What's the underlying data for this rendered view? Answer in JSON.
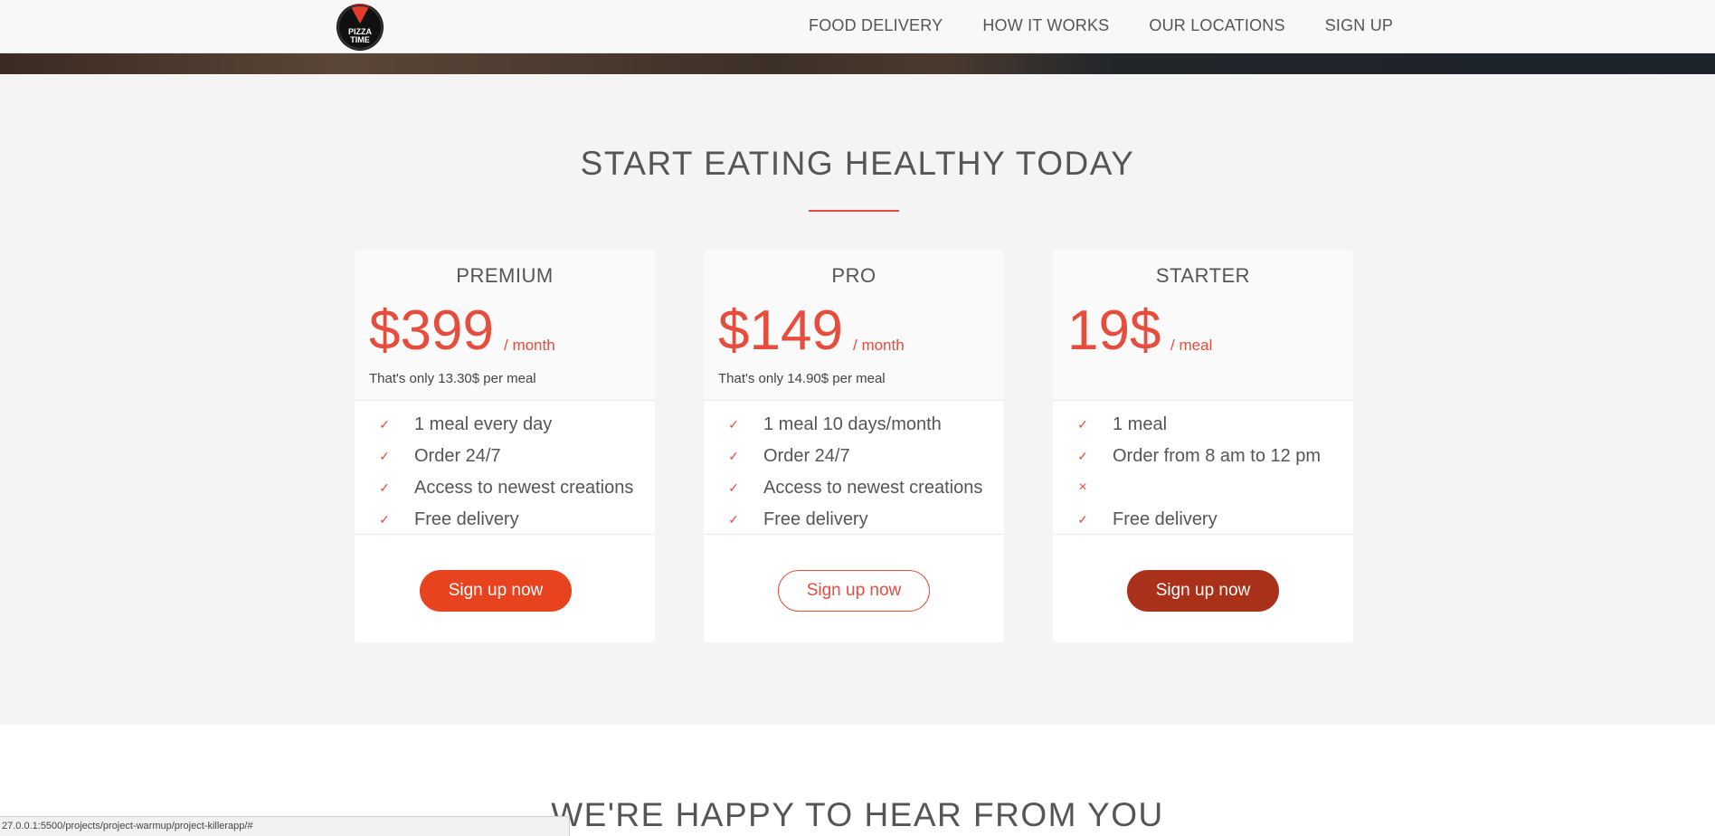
{
  "logo": {
    "line1": "PIZZA",
    "line2": "TIME"
  },
  "nav": {
    "items": [
      {
        "label": "FOOD DELIVERY"
      },
      {
        "label": "HOW IT WORKS"
      },
      {
        "label": "OUR LOCATIONS"
      },
      {
        "label": "SIGN UP"
      }
    ]
  },
  "plans_section": {
    "title": "START EATING HEALTHY TODAY",
    "plans": [
      {
        "name": "PREMIUM",
        "price": "$399",
        "unit": "/ month",
        "note": "That's only 13.30$ per meal",
        "features": [
          {
            "icon": "check-icon",
            "glyph": "✓",
            "text": "1 meal every day"
          },
          {
            "icon": "check-icon",
            "glyph": "✓",
            "text": "Order 24/7"
          },
          {
            "icon": "check-icon",
            "glyph": "✓",
            "text": "Access to newest creations"
          },
          {
            "icon": "check-icon",
            "glyph": "✓",
            "text": "Free delivery"
          }
        ],
        "button": "Sign up now"
      },
      {
        "name": "PRO",
        "price": "$149",
        "unit": "/ month",
        "note": "That's only 14.90$ per meal",
        "features": [
          {
            "icon": "check-icon",
            "glyph": "✓",
            "text": "1 meal 10 days/month"
          },
          {
            "icon": "check-icon",
            "glyph": "✓",
            "text": "Order 24/7"
          },
          {
            "icon": "check-icon",
            "glyph": "✓",
            "text": "Access to newest creations"
          },
          {
            "icon": "check-icon",
            "glyph": "✓",
            "text": "Free delivery"
          }
        ],
        "button": "Sign up now"
      },
      {
        "name": "STARTER",
        "price": "19$",
        "unit": "/ meal",
        "note": "",
        "features": [
          {
            "icon": "check-icon",
            "glyph": "✓",
            "text": "1 meal"
          },
          {
            "icon": "check-icon",
            "glyph": "✓",
            "text": "Order from 8 am to 12 pm"
          },
          {
            "icon": "cross-icon",
            "glyph": "×",
            "text": ""
          },
          {
            "icon": "check-icon",
            "glyph": "✓",
            "text": "Free delivery"
          }
        ],
        "button": "Sign up now"
      }
    ]
  },
  "testimonials_section": {
    "title": "WE'RE HAPPY TO HEAR FROM YOU"
  },
  "status_bar": {
    "url": "27.0.0.1:5500/projects/project-warmup/project-killerapp/#"
  },
  "colors": {
    "accent": "#e74c3c",
    "button_primary": "#e8431f",
    "button_dark": "#a9311a",
    "section_background": "#f4f4f4"
  }
}
